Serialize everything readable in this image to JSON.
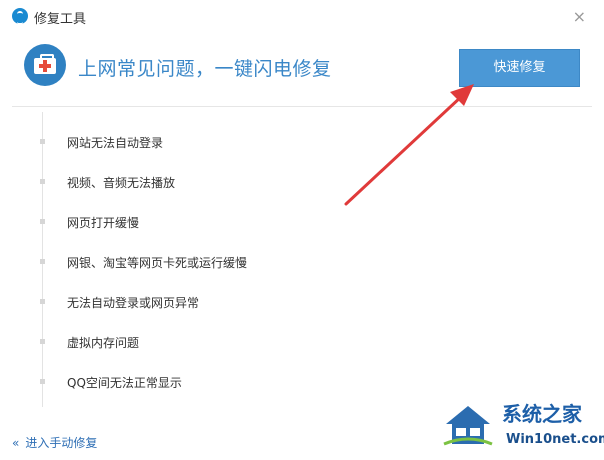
{
  "window": {
    "title": "修复工具",
    "close_glyph": "×"
  },
  "header": {
    "headline": "上网常见问题，一键闪电修复",
    "repair_button": "快速修复"
  },
  "issues": [
    "网站无法自动登录",
    "视频、音频无法播放",
    "网页打开缓慢",
    "网银、淘宝等网页卡死或运行缓慢",
    "无法自动登录或网页异常",
    "虚拟内存问题",
    "QQ空间无法正常显示"
  ],
  "footer": {
    "manual_link": "进入手动修复",
    "chevron": "«"
  },
  "watermark": {
    "brand": "系统之家",
    "site": "Win10net.com"
  },
  "colors": {
    "accent": "#4b98d6",
    "headline": "#3a87c8",
    "arrow": "#e03a3a",
    "link": "#2f6fb5"
  }
}
